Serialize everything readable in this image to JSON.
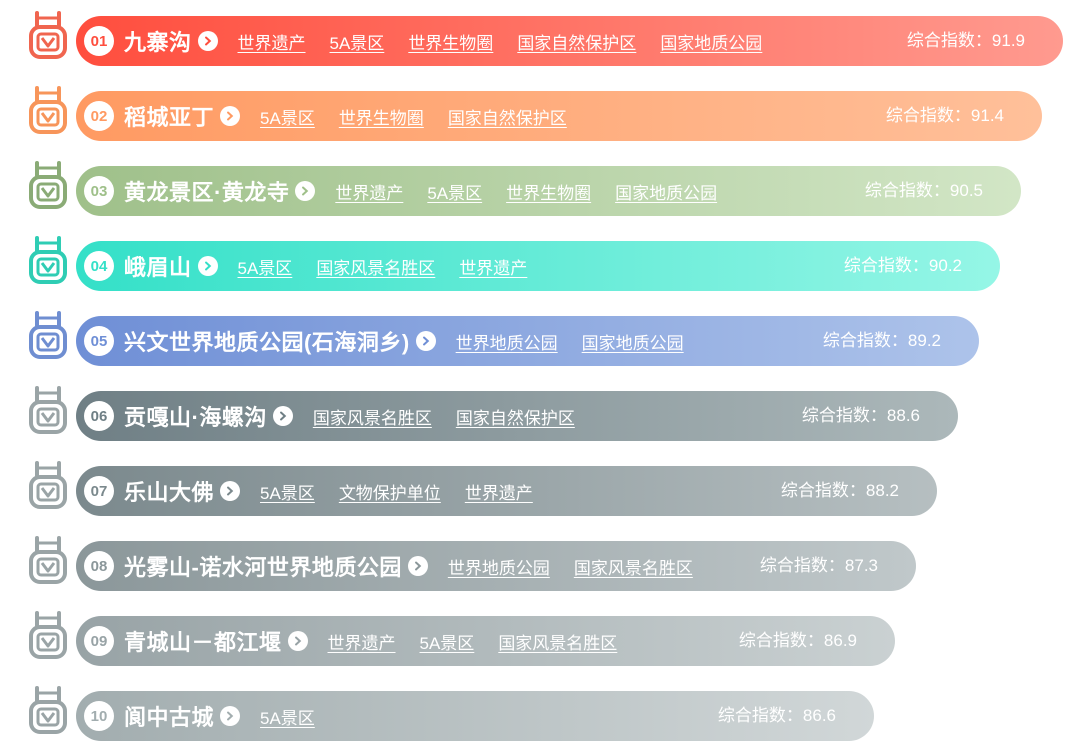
{
  "score_label": "综合指数：",
  "items": [
    {
      "rank": "01",
      "name": "九寨沟",
      "tags": [
        "世界遗产",
        "5A景区",
        "世界生物圈",
        "国家自然保护区",
        "国家地质公园"
      ],
      "score": "91.9",
      "colors": [
        "#ff4e3e",
        "#ff9a8f"
      ],
      "badge": "#f0654f"
    },
    {
      "rank": "02",
      "name": "稻城亚丁",
      "tags": [
        "5A景区",
        "世界生物圈",
        "国家自然保护区"
      ],
      "score": "91.4",
      "colors": [
        "#ff9a62",
        "#ffc09a"
      ],
      "badge": "#f7955a"
    },
    {
      "rank": "03",
      "name": "黄龙景区·黄龙寺",
      "tags": [
        "世界遗产",
        "5A景区",
        "世界生物圈",
        "国家地质公园"
      ],
      "score": "90.5",
      "colors": [
        "#9fc08a",
        "#d2e6c6"
      ],
      "badge": "#8aab76"
    },
    {
      "rank": "04",
      "name": "峨眉山",
      "tags": [
        "5A景区",
        "国家风景名胜区",
        "世界遗产"
      ],
      "score": "90.2",
      "colors": [
        "#34e0c8",
        "#95f6e6"
      ],
      "badge": "#2fcdb4"
    },
    {
      "rank": "05",
      "name": "兴文世界地质公园(石海洞乡)",
      "tags": [
        "世界地质公园",
        "国家地质公园"
      ],
      "score": "89.2",
      "colors": [
        "#6f8fd6",
        "#adc3ea"
      ],
      "badge": "#6f8ed1"
    },
    {
      "rank": "06",
      "name": "贡嘎山·海螺沟",
      "tags": [
        "国家风景名胜区",
        "国家自然保护区"
      ],
      "score": "88.6",
      "colors": [
        "#6f7f85",
        "#acb8ba"
      ],
      "badge": "#9aa4a6"
    },
    {
      "rank": "07",
      "name": "乐山大佛",
      "tags": [
        "5A景区",
        "文物保护单位",
        "世界遗产"
      ],
      "score": "88.2",
      "colors": [
        "#7b898d",
        "#b6bfc1"
      ],
      "badge": "#9aa4a6"
    },
    {
      "rank": "08",
      "name": "光雾山-诺水河世界地质公园",
      "tags": [
        "世界地质公园",
        "国家风景名胜区"
      ],
      "score": "87.3",
      "colors": [
        "#8b979a",
        "#c0c8ca"
      ],
      "badge": "#9aa4a6"
    },
    {
      "rank": "09",
      "name": "青城山－都江堰",
      "tags": [
        "世界遗产",
        "5A景区",
        "国家风景名胜区"
      ],
      "score": "86.9",
      "colors": [
        "#98a3a6",
        "#cad1d2"
      ],
      "badge": "#9aa4a6"
    },
    {
      "rank": "10",
      "name": "阆中古城",
      "tags": [
        "5A景区"
      ],
      "score": "86.6",
      "colors": [
        "#a2adaf",
        "#d1d7d8"
      ],
      "badge": "#9aa4a6"
    }
  ]
}
